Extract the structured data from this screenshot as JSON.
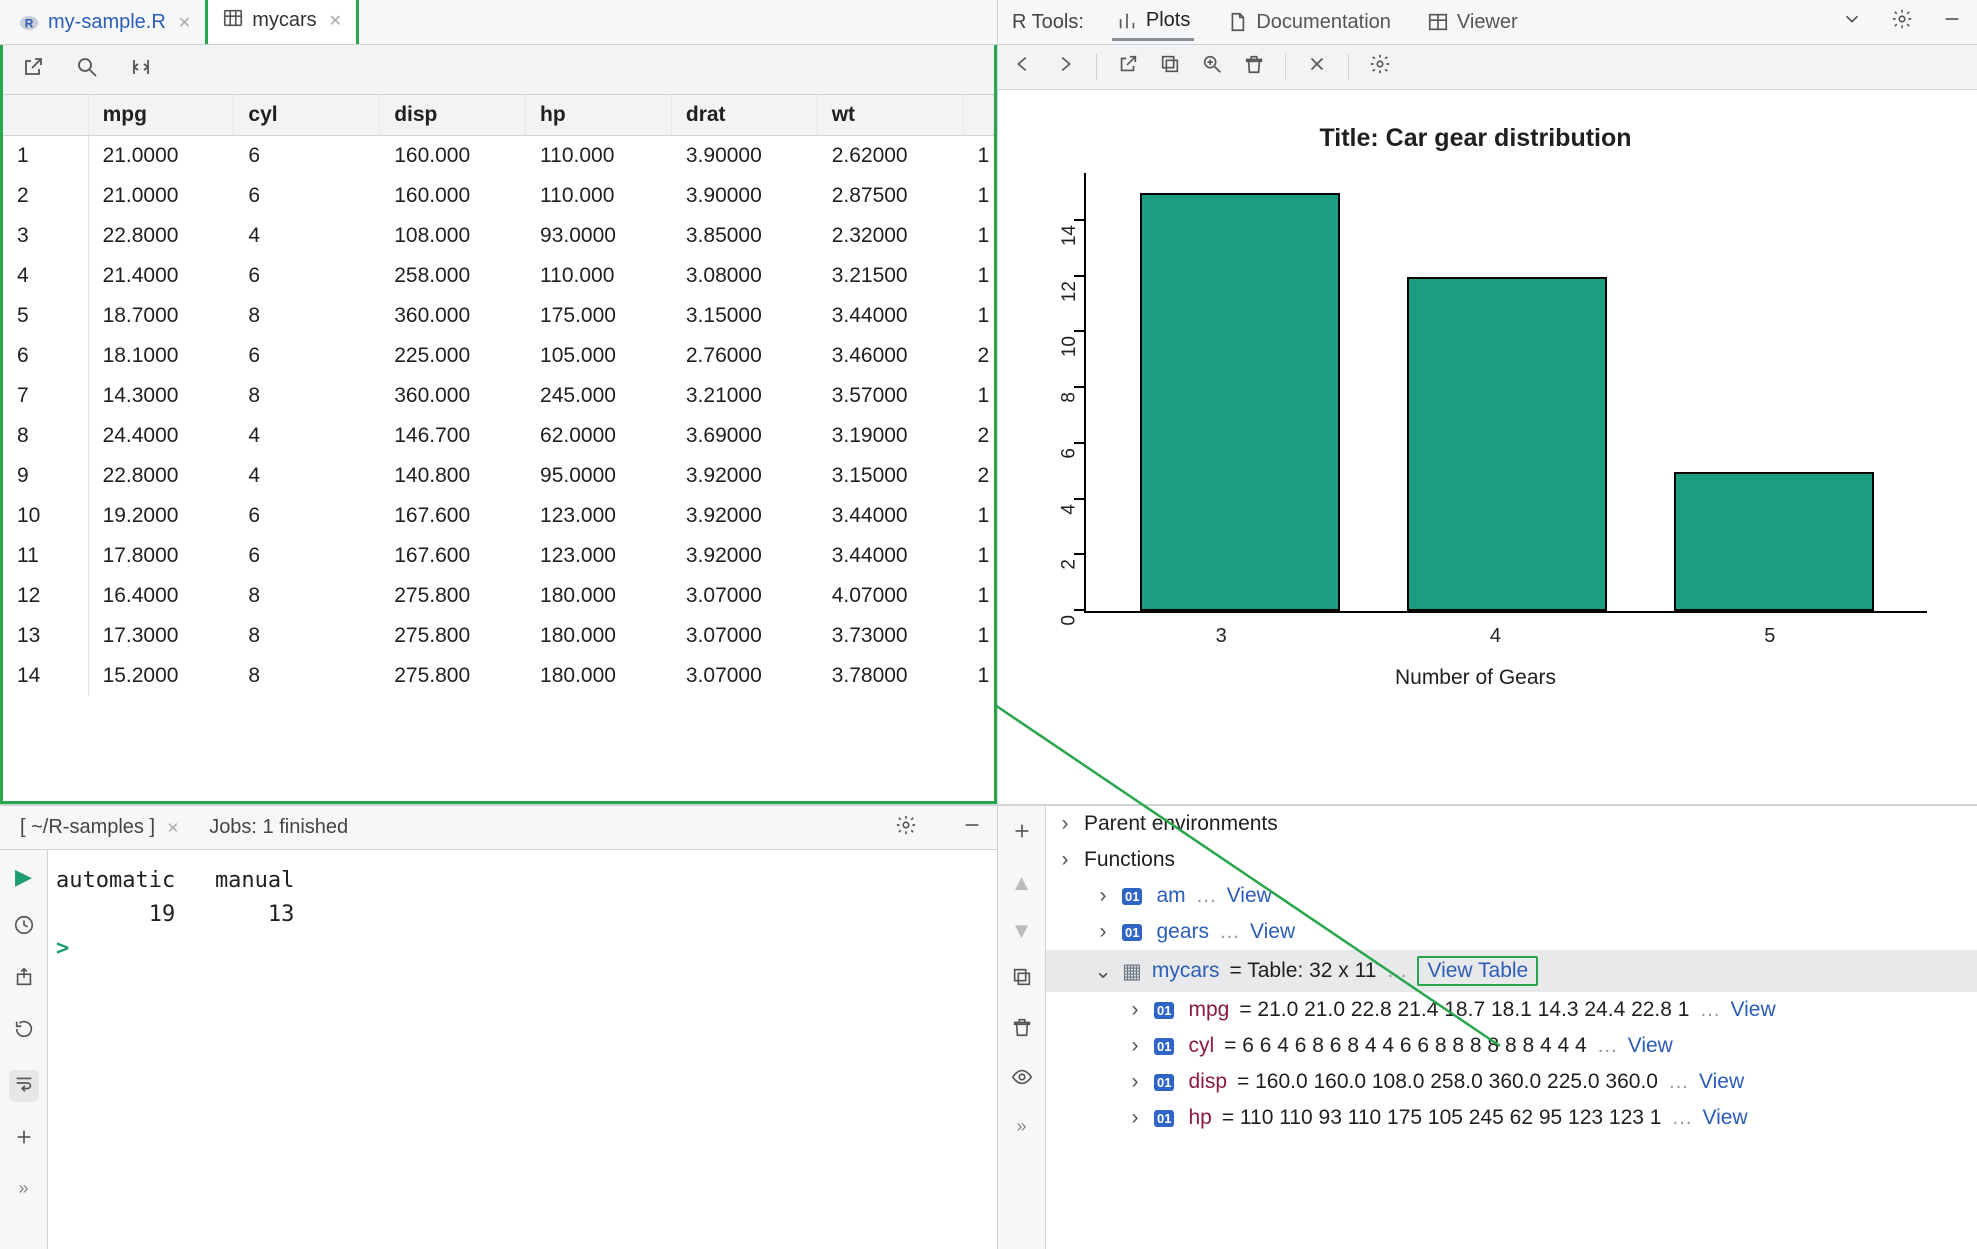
{
  "tabs": {
    "left": [
      {
        "label": "my-sample.R",
        "icon": "R"
      },
      {
        "label": "mycars",
        "icon": "table",
        "active": true
      }
    ]
  },
  "table": {
    "columns": [
      "",
      "mpg",
      "cyl",
      "disp",
      "hp",
      "drat",
      "wt",
      ""
    ],
    "rows": [
      [
        "1",
        "21.0000",
        "6",
        "160.000",
        "110.000",
        "3.90000",
        "2.62000",
        "1"
      ],
      [
        "2",
        "21.0000",
        "6",
        "160.000",
        "110.000",
        "3.90000",
        "2.87500",
        "1"
      ],
      [
        "3",
        "22.8000",
        "4",
        "108.000",
        "93.0000",
        "3.85000",
        "2.32000",
        "1"
      ],
      [
        "4",
        "21.4000",
        "6",
        "258.000",
        "110.000",
        "3.08000",
        "3.21500",
        "1"
      ],
      [
        "5",
        "18.7000",
        "8",
        "360.000",
        "175.000",
        "3.15000",
        "3.44000",
        "1"
      ],
      [
        "6",
        "18.1000",
        "6",
        "225.000",
        "105.000",
        "2.76000",
        "3.46000",
        "2"
      ],
      [
        "7",
        "14.3000",
        "8",
        "360.000",
        "245.000",
        "3.21000",
        "3.57000",
        "1"
      ],
      [
        "8",
        "24.4000",
        "4",
        "146.700",
        "62.0000",
        "3.69000",
        "3.19000",
        "2"
      ],
      [
        "9",
        "22.8000",
        "4",
        "140.800",
        "95.0000",
        "3.92000",
        "3.15000",
        "2"
      ],
      [
        "10",
        "19.2000",
        "6",
        "167.600",
        "123.000",
        "3.92000",
        "3.44000",
        "1"
      ],
      [
        "11",
        "17.8000",
        "6",
        "167.600",
        "123.000",
        "3.92000",
        "3.44000",
        "1"
      ],
      [
        "12",
        "16.4000",
        "8",
        "275.800",
        "180.000",
        "3.07000",
        "4.07000",
        "1"
      ],
      [
        "13",
        "17.3000",
        "8",
        "275.800",
        "180.000",
        "3.07000",
        "3.73000",
        "1"
      ],
      [
        "14",
        "15.2000",
        "8",
        "275.800",
        "180.000",
        "3.07000",
        "3.78000",
        "1"
      ]
    ]
  },
  "rtools": {
    "label": "R Tools:",
    "tabs": [
      {
        "label": "Plots",
        "active": true
      },
      {
        "label": "Documentation"
      },
      {
        "label": "Viewer"
      }
    ]
  },
  "plot": {
    "title": "Title: Car gear distribution",
    "xlabel": "Number of Gears"
  },
  "chart_data": {
    "type": "bar",
    "categories": [
      "3",
      "4",
      "5"
    ],
    "values": [
      15,
      12,
      5
    ],
    "title": "Title: Car gear distribution",
    "xlabel": "Number of Gears",
    "ylabel": "",
    "ylim": [
      0,
      15
    ],
    "yticks": [
      0,
      2,
      4,
      6,
      8,
      10,
      12,
      14
    ]
  },
  "console": {
    "tab_label": "[ ~/R-samples ]",
    "jobs_label": "Jobs: 1 finished",
    "header1": "automatic",
    "header2": "manual",
    "val1": "19",
    "val2": "13",
    "prompt": ">"
  },
  "env": {
    "parent_label": "Parent environments",
    "functions_label": "Functions",
    "items": [
      {
        "name": "am",
        "tail": " … ",
        "link": "View"
      },
      {
        "name": "gears",
        "tail": " … ",
        "link": "View"
      }
    ],
    "mycars": {
      "name": "mycars",
      "eq": " = Table: 32 x 11",
      "tail": " … ",
      "link": "View Table"
    },
    "cols": [
      {
        "name": "mpg",
        "vals": " = 21.0 21.0 22.8 21.4 18.7 18.1 14.3 24.4 22.8 1",
        "link": "View"
      },
      {
        "name": "cyl",
        "vals": " = 6 6 4 6 8 6 8 4 4 6 6 8 8 8 8 8 8 4 4 4 ",
        "link": "View"
      },
      {
        "name": "disp",
        "vals": " = 160.0 160.0 108.0 258.0 360.0 225.0 360.0 ",
        "link": "View"
      },
      {
        "name": "hp",
        "vals": " = 110 110  93 110 175 105 245  62  95 123 123 1",
        "link": "View"
      }
    ]
  }
}
